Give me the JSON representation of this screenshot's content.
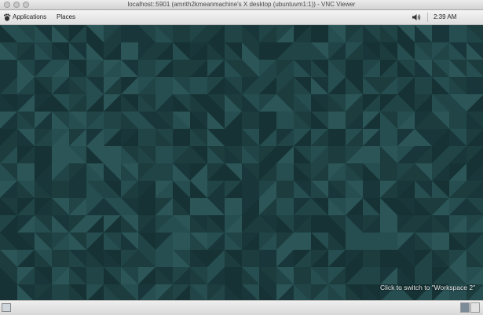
{
  "window": {
    "title": "localhost::5901 (amrith2kmeanmachine's X desktop (ubuntuvm1:1)) - VNC Viewer"
  },
  "top_panel": {
    "applications_label": "Applications",
    "places_label": "Places",
    "volume_icon": "speaker-icon",
    "clock": "2:39 AM"
  },
  "desktop": {
    "wallpaper_colors": [
      "#163234",
      "#1c3c3e",
      "#214547",
      "#264d4f",
      "#2b5557",
      "#19373a"
    ],
    "workspace_tooltip": "Click to switch to \"Workspace 2\""
  },
  "bottom_panel": {
    "show_desktop_icon": "desktop-icon",
    "workspaces": [
      "Workspace 1",
      "Workspace 2"
    ],
    "active_workspace": "Workspace 1"
  }
}
